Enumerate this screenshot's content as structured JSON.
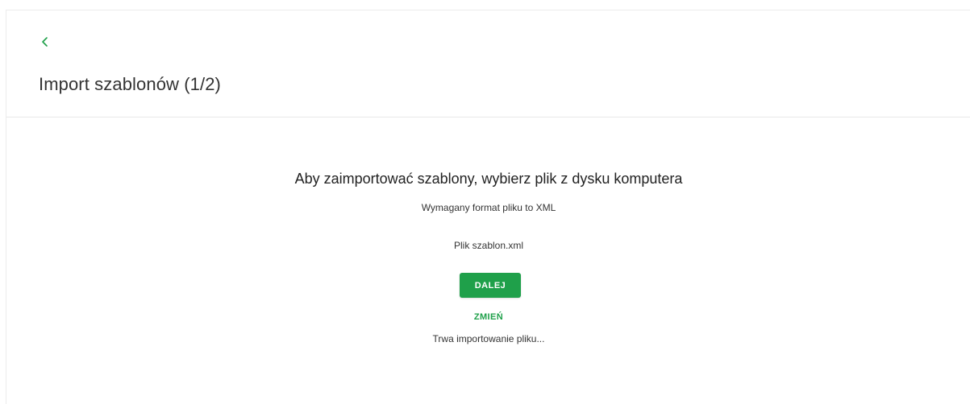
{
  "header": {
    "back_icon": "chevron-left-icon",
    "title": "Import szablonów (1/2)"
  },
  "main": {
    "heading": "Aby zaimportować szablony, wybierz plik z dysku komputera",
    "format_note": "Wymagany format pliku to XML",
    "file_name": "Plik szablon.xml",
    "next_button_label": "DALEJ",
    "change_link_label": "ZMIEŃ",
    "status_text": "Trwa importowanie pliku..."
  },
  "colors": {
    "accent": "#1fa04a",
    "border": "#e8e8e8",
    "text": "#222222"
  }
}
